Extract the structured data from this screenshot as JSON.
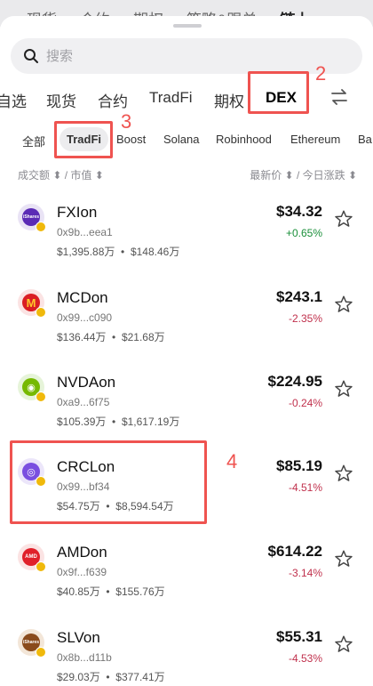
{
  "background_tabs": [
    "现货",
    "合约",
    "期权",
    "策略&跟单",
    "链上"
  ],
  "search": {
    "placeholder": "搜索"
  },
  "categories": [
    "自选",
    "现货",
    "合约",
    "TradFi",
    "期权",
    "DEX"
  ],
  "active_category": "DEX",
  "subcategories": [
    "全部",
    "TradFi",
    "Boost",
    "Solana",
    "Robinhood",
    "Ethereum",
    "Ba"
  ],
  "active_subcategory": "TradFi",
  "table_header": {
    "left": "成交额 ⬍ / 市值 ⬍",
    "right": "最新价 ⬍ / 今日涨跌 ⬍"
  },
  "tokens": [
    {
      "name": "FXIon",
      "address": "0x9b...eea1",
      "volume": "$1,395.88万",
      "mcap": "$148.46万",
      "price": "$34.32",
      "change": "+0.65%",
      "dir": "up",
      "logo": "ishares"
    },
    {
      "name": "MCDon",
      "address": "0x99...c090",
      "volume": "$136.44万",
      "mcap": "$21.68万",
      "price": "$243.1",
      "change": "-2.35%",
      "dir": "down",
      "logo": "mcd"
    },
    {
      "name": "NVDAon",
      "address": "0xa9...6f75",
      "volume": "$105.39万",
      "mcap": "$1,617.19万",
      "price": "$224.95",
      "change": "-0.24%",
      "dir": "down",
      "logo": "nvda"
    },
    {
      "name": "CRCLon",
      "address": "0x99...bf34",
      "volume": "$54.75万",
      "mcap": "$8,594.54万",
      "price": "$85.19",
      "change": "-4.51%",
      "dir": "down",
      "logo": "crcl"
    },
    {
      "name": "AMDon",
      "address": "0x9f...f639",
      "volume": "$40.85万",
      "mcap": "$155.76万",
      "price": "$614.22",
      "change": "-3.14%",
      "dir": "down",
      "logo": "amd"
    },
    {
      "name": "SLVon",
      "address": "0x8b...d11b",
      "volume": "$29.03万",
      "mcap": "$377.41万",
      "price": "$55.31",
      "change": "-4.53%",
      "dir": "down",
      "logo": "slv"
    }
  ],
  "logo_text": {
    "ishares": "iShares",
    "amd": "AMD",
    "slv": "iShares"
  },
  "annotations": [
    "2",
    "3",
    "4"
  ],
  "colors": {
    "up": "#1a8f3a",
    "down": "#c0304c",
    "annotation": "#ef5350",
    "chain_badge": "#f0b90b"
  }
}
